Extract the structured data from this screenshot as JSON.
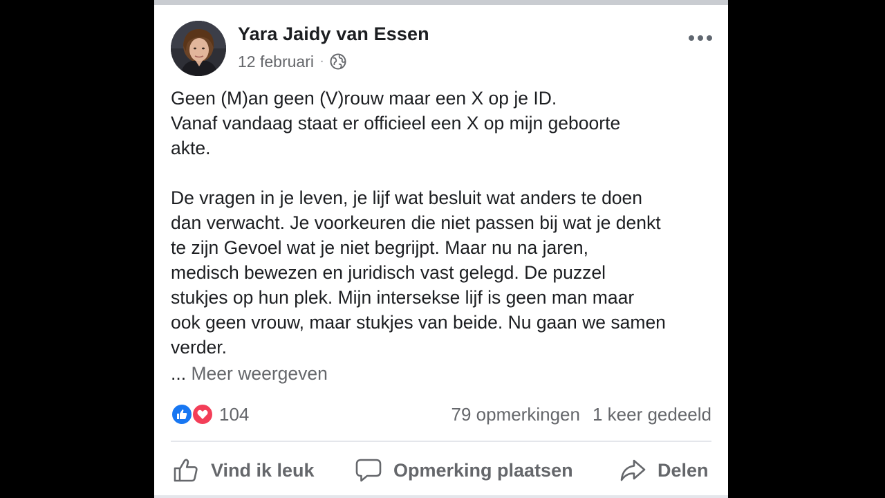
{
  "post": {
    "author": "Yara Jaidy van Essen",
    "date": "12 februari",
    "separator": "·",
    "privacy_icon": "globe-icon",
    "more_icon": "ellipsis-icon",
    "paragraphs": [
      {
        "lines": [
          "Geen (M)an geen (V)rouw maar een X op je ID.",
          "Vanaf vandaag staat er officieel een X op mijn geboorte",
          "akte."
        ]
      },
      {
        "lines": [
          "De vragen in je leven, je lijf wat besluit wat anders te doen",
          "dan verwacht. Je voorkeuren die niet passen bij wat je denkt",
          "te zijn  Gevoel wat je niet begrijpt. Maar nu na jaren,",
          "medisch bewezen en juridisch vast gelegd. De puzzel",
          "stukjes op hun plek. Mijn intersekse lijf is geen man maar",
          "ook geen vrouw, maar stukjes van beide. Nu gaan we samen",
          "verder."
        ]
      }
    ],
    "see_more_prefix": "...",
    "see_more_label": "Meer weergeven"
  },
  "stats": {
    "reactions": [
      "like",
      "love"
    ],
    "reaction_count": "104",
    "comments": "79 opmerkingen",
    "shares": "1 keer gedeeld"
  },
  "actions": {
    "like_label": "Vind ik leuk",
    "comment_label": "Opmerking plaatsen",
    "share_label": "Delen"
  },
  "colors": {
    "text": "#1c1e21",
    "secondary": "#65676b",
    "like_blue": "#1877f2",
    "love_red": "#f33e58",
    "divider": "#e4e6eb"
  }
}
